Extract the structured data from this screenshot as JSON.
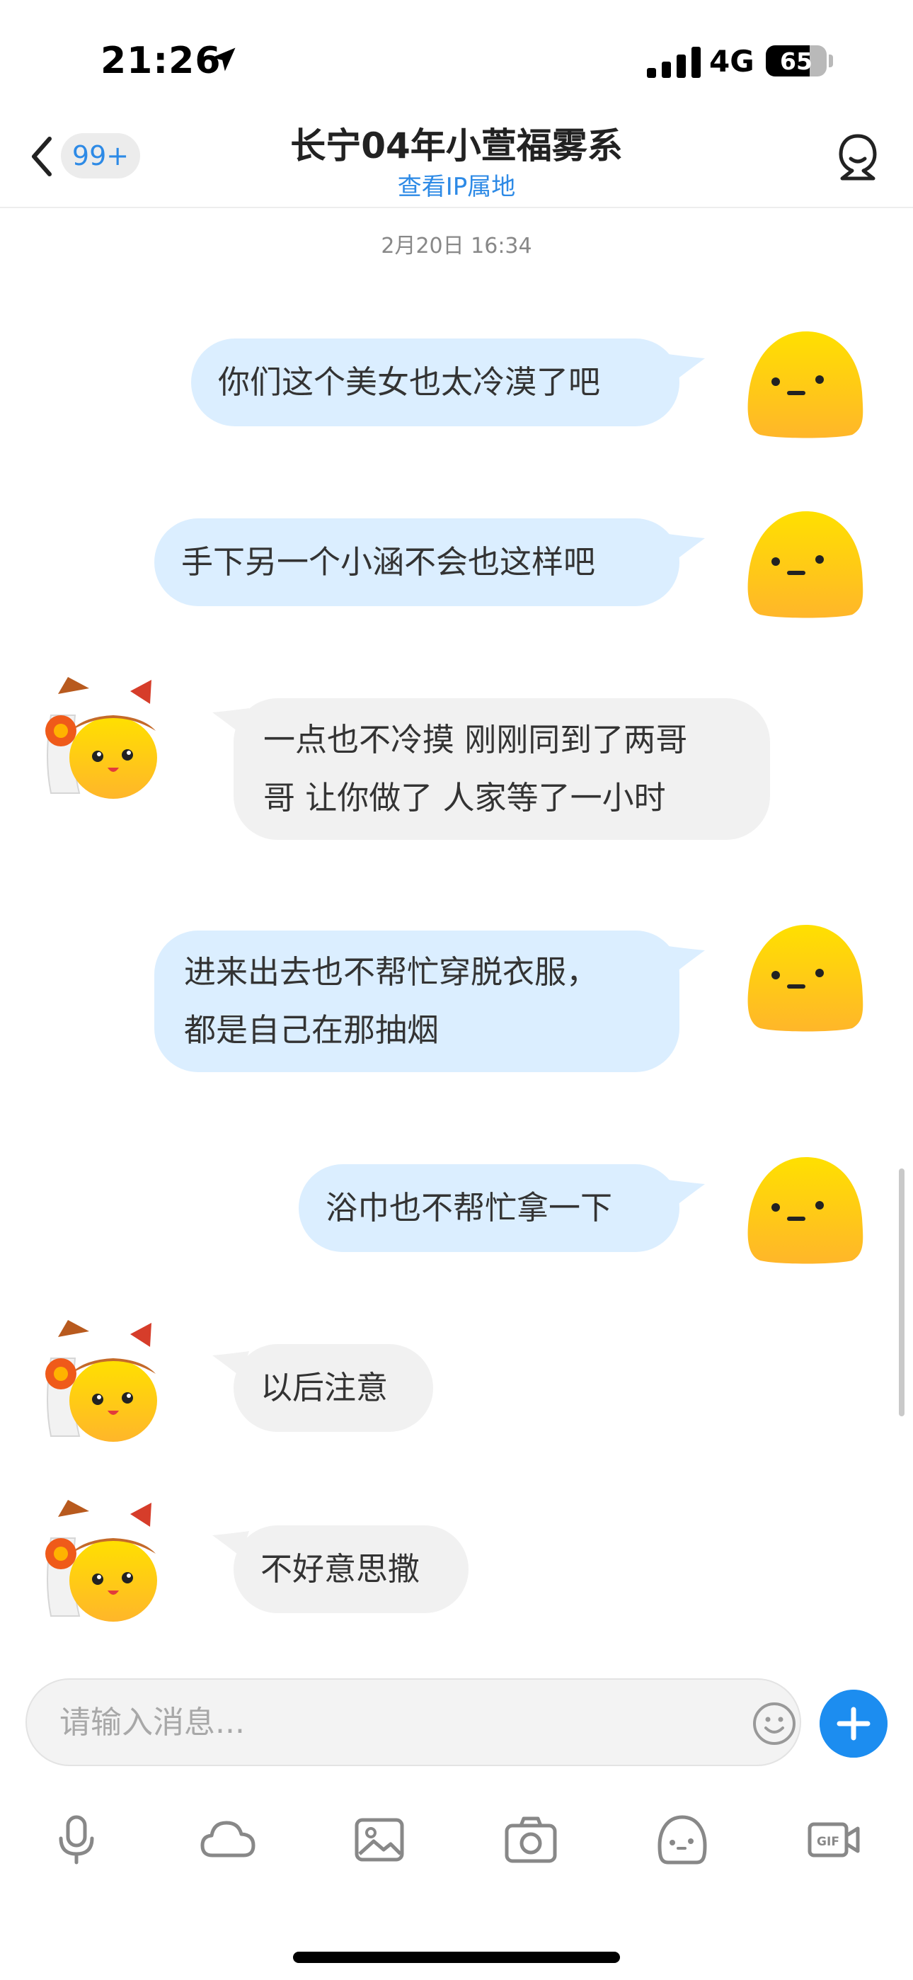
{
  "status_bar": {
    "time": "21:26",
    "network": "4G",
    "battery": "65"
  },
  "header": {
    "back_badge": "99+",
    "title": "长宁04年小萱福雾系",
    "subtitle": "查看IP属地"
  },
  "timestamp": "2月20日 16:34",
  "messages": [
    {
      "direction": "outgoing",
      "text": "你们这个美女也太冷漠了吧"
    },
    {
      "direction": "outgoing",
      "text": "手下另一个小涵不会也这样吧"
    },
    {
      "direction": "incoming",
      "text": "一点也不冷摸 刚刚同到了两哥\n哥 让你做了 人家等了一小时"
    },
    {
      "direction": "outgoing",
      "text": "进来出去也不帮忙穿脱衣服，\n都是自己在那抽烟"
    },
    {
      "direction": "outgoing",
      "text": "浴巾也不帮忙拿一下"
    },
    {
      "direction": "incoming",
      "text": "以后注意"
    },
    {
      "direction": "incoming",
      "text": "不好意思撒"
    }
  ],
  "input": {
    "placeholder": "请输入消息..."
  },
  "toolbar": {
    "items": [
      "microphone-icon",
      "cloud-icon",
      "image-icon",
      "camera-icon",
      "sticker-icon",
      "gif-icon"
    ]
  },
  "colors": {
    "accent": "#1c8df0",
    "outgoing_bubble": "#dbeeff",
    "incoming_bubble": "#f1f1f1",
    "avatar_yellow": "#ffc928"
  }
}
